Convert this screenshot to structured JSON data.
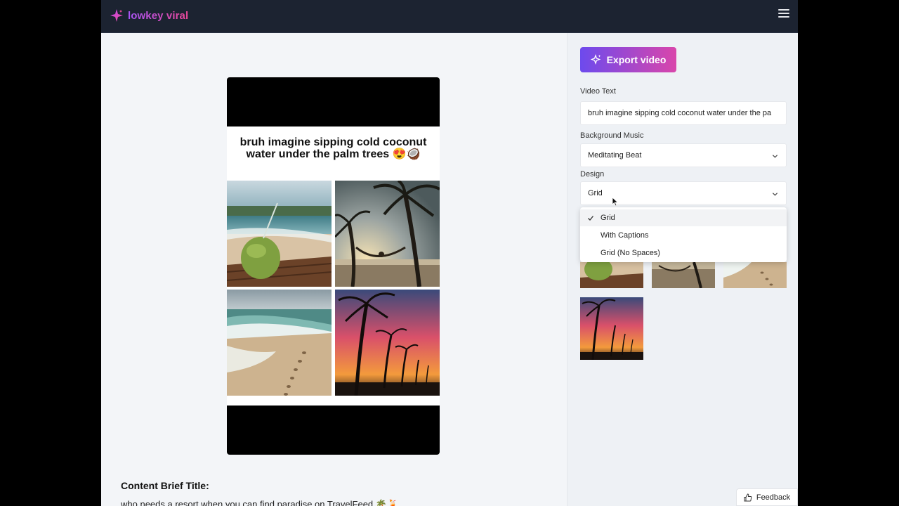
{
  "app": {
    "name": "lowkey viral"
  },
  "header": {
    "menu_icon": "hamburger-icon"
  },
  "preview": {
    "caption": "bruh imagine sipping cold coconut water under the palm trees 😍🥥",
    "images": [
      {
        "name": "coconut-on-beach-image"
      },
      {
        "name": "palm-hammock-sunset-image"
      },
      {
        "name": "waves-footprints-image"
      },
      {
        "name": "palm-sunset-image"
      }
    ]
  },
  "brief": {
    "title": "Content Brief Title:",
    "text": "who needs a resort when you can find paradise on TravelFeed 🌴🍹"
  },
  "panel": {
    "export_label": "Export video",
    "video_text_label": "Video Text",
    "video_text_value": "bruh imagine sipping cold coconut water under the pa",
    "music_label": "Background Music",
    "music_value": "Meditating Beat",
    "design_label": "Design",
    "design_value": "Grid",
    "design_options": [
      "Grid",
      "With Captions",
      "Grid (No Spaces)"
    ],
    "design_selected": "Grid"
  },
  "feedback": {
    "label": "Feedback"
  },
  "colors": {
    "accent_start": "#6d4aed",
    "accent_end": "#d946ab",
    "topbar": "#1c2331"
  }
}
